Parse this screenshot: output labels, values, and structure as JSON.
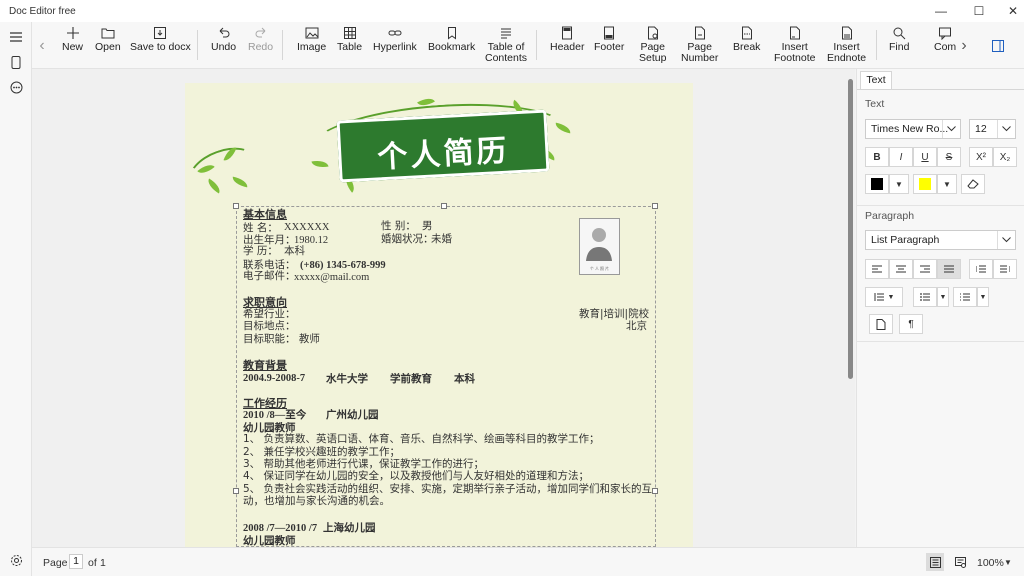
{
  "app": {
    "title": "Doc Editor free"
  },
  "toolbar": {
    "new": "New",
    "open": "Open",
    "save_docx": "Save to docx",
    "undo": "Undo",
    "redo": "Redo",
    "image": "Image",
    "table": "Table",
    "hyperlink": "Hyperlink",
    "bookmark": "Bookmark",
    "toc_line1": "Table of",
    "toc_line2": "Contents",
    "header": "Header",
    "footer": "Footer",
    "page_setup_line1": "Page",
    "page_setup_line2": "Setup",
    "page_number_line1": "Page",
    "page_number_line2": "Number",
    "break": "Break",
    "insert_footnote_line1": "Insert",
    "insert_footnote_line2": "Footnote",
    "insert_endnote_line1": "Insert",
    "insert_endnote_line2": "Endnote",
    "find": "Find",
    "comment_partial": "Com"
  },
  "document": {
    "banner_title": "个人简历",
    "photo_caption": "个 人 照 片",
    "sections": {
      "basic_info": "基本信息",
      "name_label": "姓    名：",
      "name_value": "XXXXXX",
      "gender_label": "性    别：",
      "gender_value": "男",
      "birth_label": "出生年月：",
      "birth_value": "1980.12",
      "marital_label": "婚姻状况：",
      "marital_value": "未婚",
      "education_label": "学    历：",
      "education_value": "本科",
      "phone_label": "联系电话：",
      "phone_value": "(+86)  1345-678-999",
      "email_label": "电子邮件：",
      "email_value": "xxxxx@mail.com",
      "intent": "求职意向",
      "industry_label": "希望行业：",
      "industry_value": "教育|培训|院校",
      "location_label": "目标地点：",
      "location_value": "北京",
      "role_label": "目标职能： 教师",
      "edu_bg": "教育背景",
      "edu_line_date": "2004.9-2008-7",
      "edu_school": "水牛大学",
      "edu_major": "学前教育",
      "edu_degree": "本科",
      "work": "工作经历",
      "job1_date": "2010 /8—至今",
      "job1_company": "广州幼儿园",
      "job1_title": "幼儿园教师",
      "job1_duties": [
        "1、  负责算数、英语口语、体育、音乐、自然科学、绘画等科目的教学工作；",
        "2、  兼任学校兴趣班的教学工作；",
        "3、  帮助其他老师进行代课，保证教学工作的进行；",
        "4、  保证同学在幼儿园的安全，以及教授他们与人友好相处的道理和方法；",
        "5、  负责社会实践活动的组织、安排、实施，定期举行亲子活动，增加同学们和家长的互",
        "      动，也增加与家长沟通的机会。"
      ],
      "job2_date": "2008 /7—2010 /7",
      "job2_company": "上海幼儿园",
      "job2_title": "幼儿园教师"
    }
  },
  "statusbar": {
    "page_label": "Page",
    "page_number": "1",
    "of_label": "of",
    "page_total": "1",
    "zoom": "100%"
  },
  "panel": {
    "tab": "Text",
    "text_section": "Text",
    "font_family": "Times New Ro...",
    "font_size": "12",
    "bold": "B",
    "italic": "I",
    "underline": "U",
    "strike": "S",
    "superscript": "X²",
    "subscript": "X₂",
    "font_color": "#000000",
    "highlight_color": "#ffff00",
    "paragraph_section": "Paragraph",
    "paragraph_style": "List Paragraph",
    "pilcrow": "¶"
  }
}
